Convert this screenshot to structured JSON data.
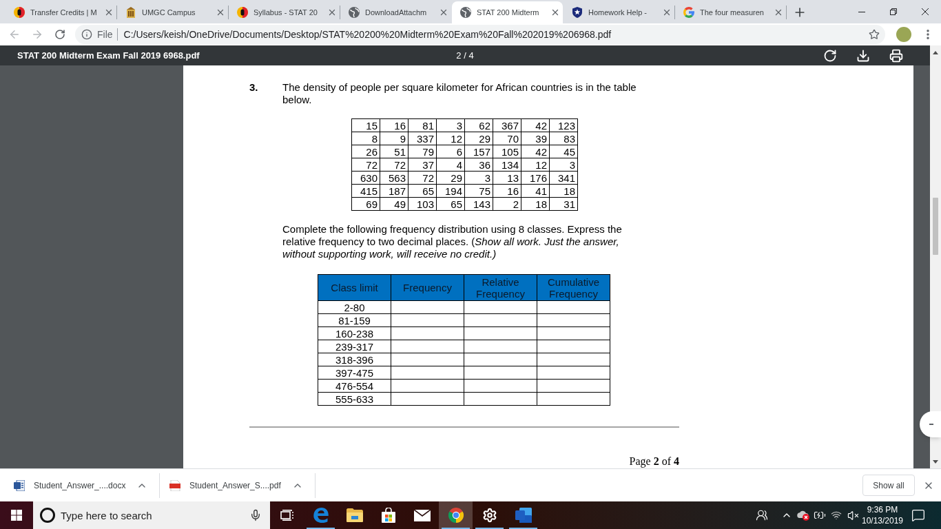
{
  "browser": {
    "tabs": [
      {
        "kind": "umgc",
        "title": "Transfer Credits | M",
        "selected": false
      },
      {
        "kind": "campus",
        "title": "UMGC Campus",
        "selected": false
      },
      {
        "kind": "umgc",
        "title": "Syllabus - STAT 20",
        "selected": false
      },
      {
        "kind": "globe",
        "title": "DownloadAttachm",
        "selected": false
      },
      {
        "kind": "globe",
        "title": "STAT 200 Midterm",
        "selected": true
      },
      {
        "kind": "shield",
        "title": "Homework Help -",
        "selected": false
      },
      {
        "kind": "google",
        "title": "The four measuren",
        "selected": false
      }
    ],
    "nav_buttons": [
      {
        "kind": "back",
        "disabled": true
      },
      {
        "kind": "forward",
        "disabled": true
      },
      {
        "kind": "reload",
        "disabled": false
      }
    ],
    "omnibox": {
      "security_label": "File",
      "url": "C:/Users/keish/OneDrive/Documents/Desktop/STAT%20200%20Midterm%20Exam%20Fall%202019%206968.pdf"
    }
  },
  "pdf_viewer": {
    "title": "STAT 200 Midterm Exam Fall 2019 6968.pdf",
    "page_indicator": "2 / 4"
  },
  "document": {
    "question_number": "3.",
    "prompt": "The density of people per square kilometer for African countries is in the table below.",
    "data_table": [
      [
        "15",
        "16",
        "81",
        "3",
        "62",
        "367",
        "42",
        "123"
      ],
      [
        "8",
        "9",
        "337",
        "12",
        "29",
        "70",
        "39",
        "83"
      ],
      [
        "26",
        "51",
        "79",
        "6",
        "157",
        "105",
        "42",
        "45"
      ],
      [
        "72",
        "72",
        "37",
        "4",
        "36",
        "134",
        "12",
        "3"
      ],
      [
        "630",
        "563",
        "72",
        "29",
        "3",
        "13",
        "176",
        "341"
      ],
      [
        "415",
        "187",
        "65",
        "194",
        "75",
        "16",
        "41",
        "18"
      ],
      [
        "69",
        "49",
        "103",
        "65",
        "143",
        "2",
        "18",
        "31"
      ]
    ],
    "instructions": "Complete the following frequency distribution using 8 classes. Express the relative frequency to two decimal places. (*Show all work. Just the answer, without supporting work, will receive no credit.)*",
    "frequency_table": {
      "columns": [
        "Class limit",
        "Frequency",
        "Relative Frequency",
        "Cumulative Frequency"
      ],
      "rows": [
        {
          "class_limit": "2-80"
        },
        {
          "class_limit": "81-159"
        },
        {
          "class_limit": "160-238"
        },
        {
          "class_limit": "239-317"
        },
        {
          "class_limit": "318-396"
        },
        {
          "class_limit": "397-475"
        },
        {
          "class_limit": "476-554"
        },
        {
          "class_limit": "555-633"
        }
      ]
    },
    "footer": "Page **2** of **4**"
  },
  "downloads": {
    "items": [
      {
        "kind": "word",
        "name": "Student_Answer_....docx"
      },
      {
        "kind": "pdf",
        "name": "Student_Answer_S....pdf"
      }
    ],
    "show_all": "Show all"
  },
  "taskbar": {
    "search_placeholder": "Type here to search",
    "apps": [
      {
        "kind": "edge",
        "running": true,
        "active": false
      },
      {
        "kind": "explorer",
        "running": false,
        "active": false
      },
      {
        "kind": "store",
        "running": false,
        "active": false
      },
      {
        "kind": "mail",
        "running": false,
        "active": false
      },
      {
        "kind": "chrome",
        "running": true,
        "active": true
      },
      {
        "kind": "settings",
        "running": true,
        "active": false
      },
      {
        "kind": "word",
        "running": true,
        "active": false
      }
    ],
    "time": "9:36 PM",
    "date": "10/13/2019"
  }
}
